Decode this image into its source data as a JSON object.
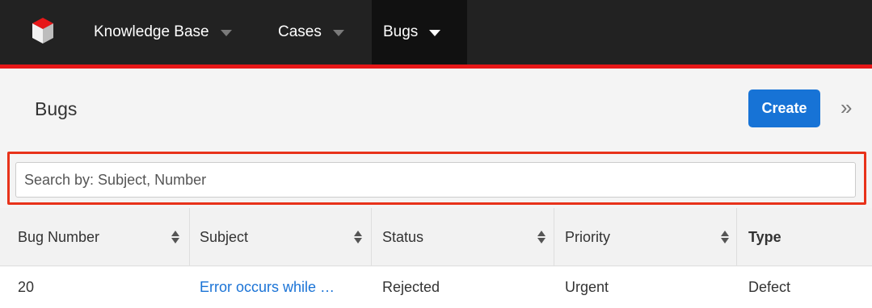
{
  "nav": {
    "items": [
      {
        "label": "Knowledge Base",
        "active": false
      },
      {
        "label": "Cases",
        "active": false
      },
      {
        "label": "Bugs",
        "active": true
      }
    ]
  },
  "header": {
    "title": "Bugs",
    "create_label": "Create",
    "collapse_glyph": "»"
  },
  "search": {
    "placeholder": "Search by: Subject, Number",
    "value": ""
  },
  "table": {
    "columns": [
      "Bug Number",
      "Subject",
      "Status",
      "Priority",
      "Type"
    ],
    "rows": [
      {
        "bug_number": "20",
        "subject": "Error occurs while …",
        "status": "Rejected",
        "priority": "Urgent",
        "type": "Defect"
      }
    ]
  },
  "colors": {
    "topbar": "#222222",
    "accent_red": "#e61718",
    "primary_button": "#1773d6",
    "link": "#1a73d6",
    "highlight_border": "#e8321a"
  },
  "icons": {
    "logo": "cube-logo-icon",
    "nav_caret": "caret-down-icon",
    "sort": "sort-icon"
  }
}
